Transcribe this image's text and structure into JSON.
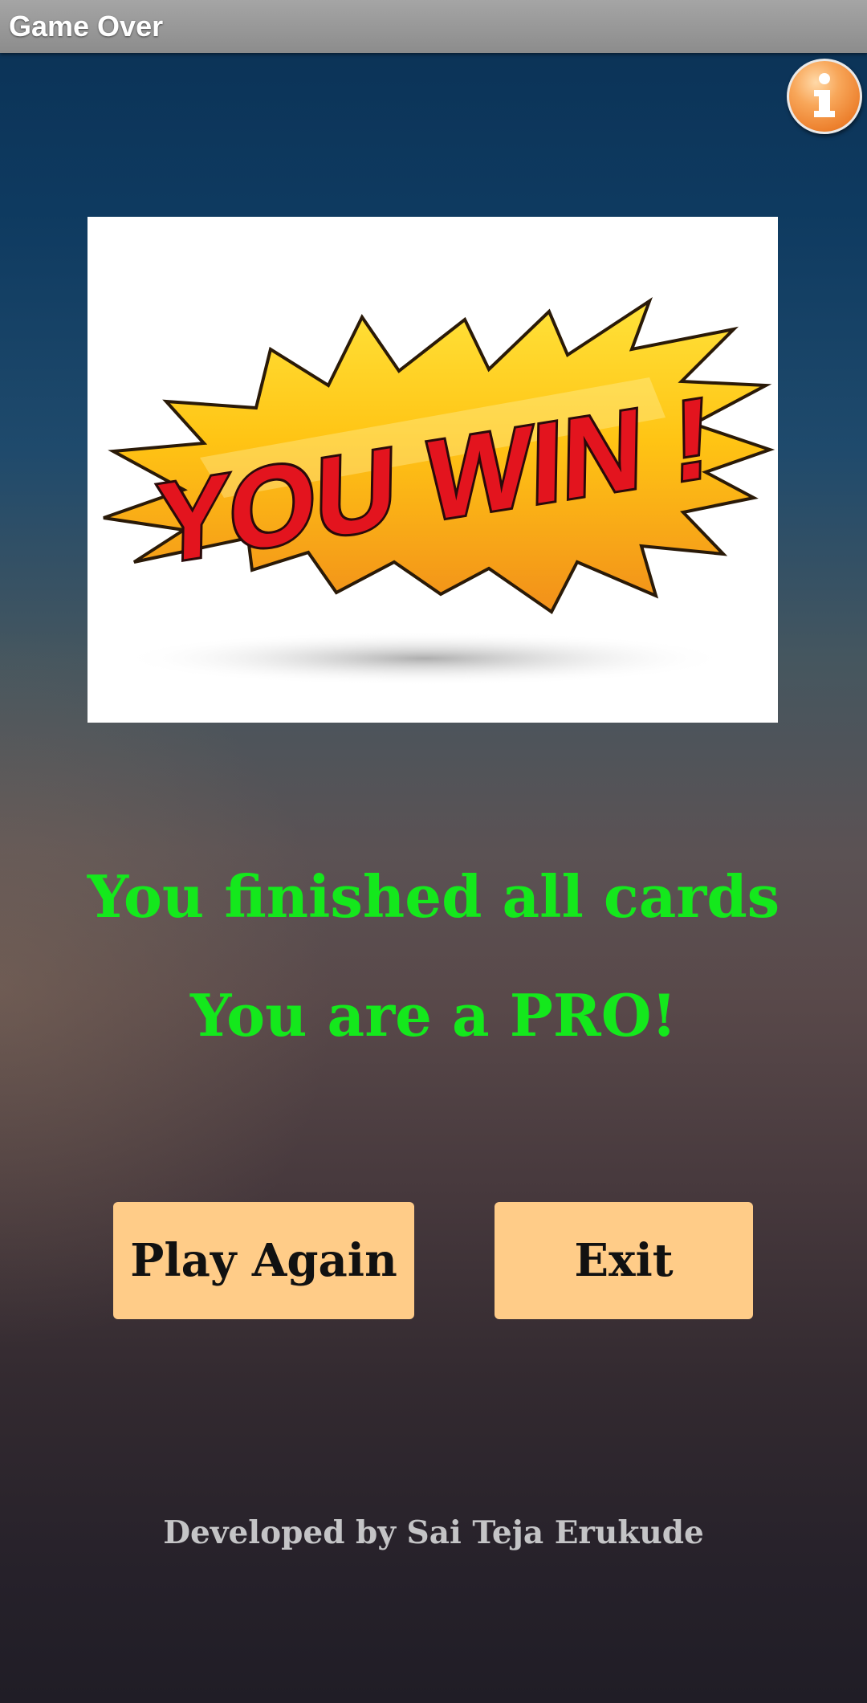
{
  "app": {
    "title": "Game Over"
  },
  "header": {
    "info_icon": "info-icon"
  },
  "banner": {
    "text": "YOU WIN !",
    "colors": {
      "burst_yellow": "#ffd21a",
      "burst_orange": "#f39b1e",
      "letter_red": "#e3141e"
    }
  },
  "messages": {
    "line1": "You finished all cards",
    "line2": "You are a PRO!",
    "color": "#14e81c"
  },
  "buttons": {
    "play_again": "Play Again",
    "exit": "Exit",
    "color": "#ffcc88"
  },
  "footer": {
    "credit": "Developed by Sai Teja Erukude"
  }
}
